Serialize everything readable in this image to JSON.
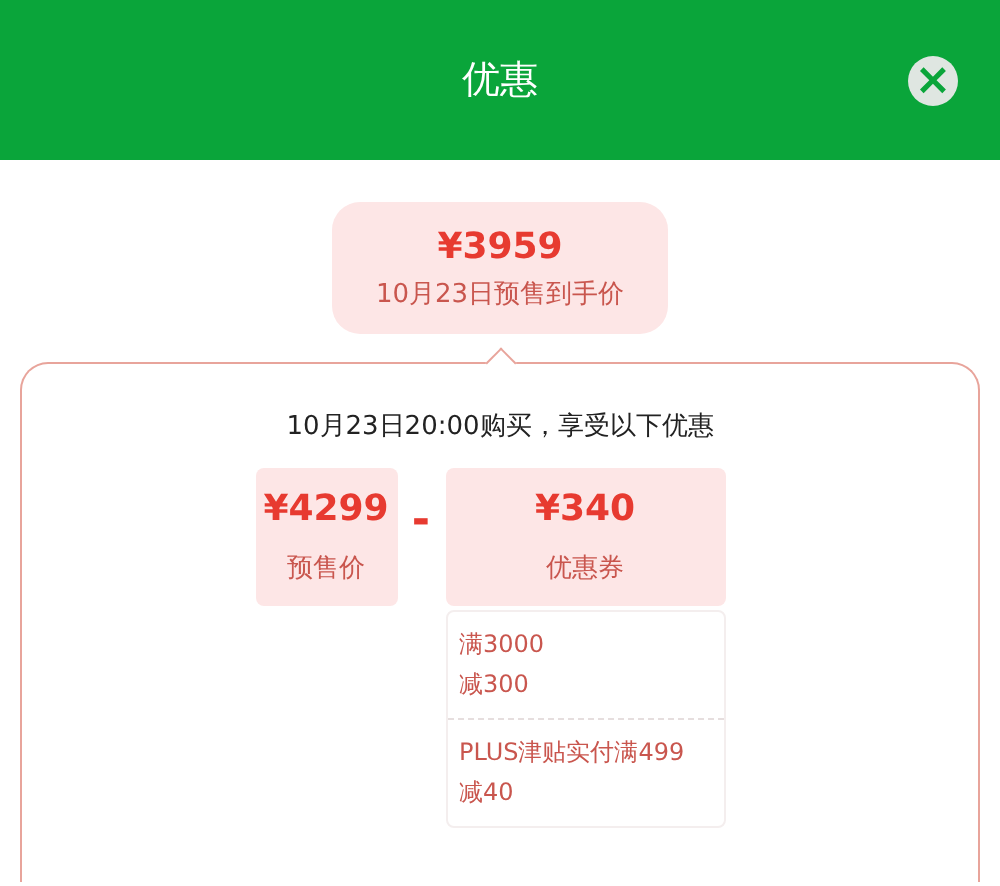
{
  "header": {
    "title": "优惠",
    "close_icon": "×"
  },
  "final_price": {
    "amount": "¥3959",
    "caption": "10月23日预售到手价"
  },
  "note": "10月23日20:00购买，享受以下优惠",
  "presale": {
    "amount": "¥4299",
    "caption": "预售价"
  },
  "operator": "-",
  "coupon": {
    "amount": "¥340",
    "caption": "优惠券"
  },
  "coupon_items": [
    {
      "lines": [
        "满3000",
        "减300"
      ]
    },
    {
      "lines": [
        "PLUS津贴实付满499",
        "减40"
      ]
    }
  ]
}
